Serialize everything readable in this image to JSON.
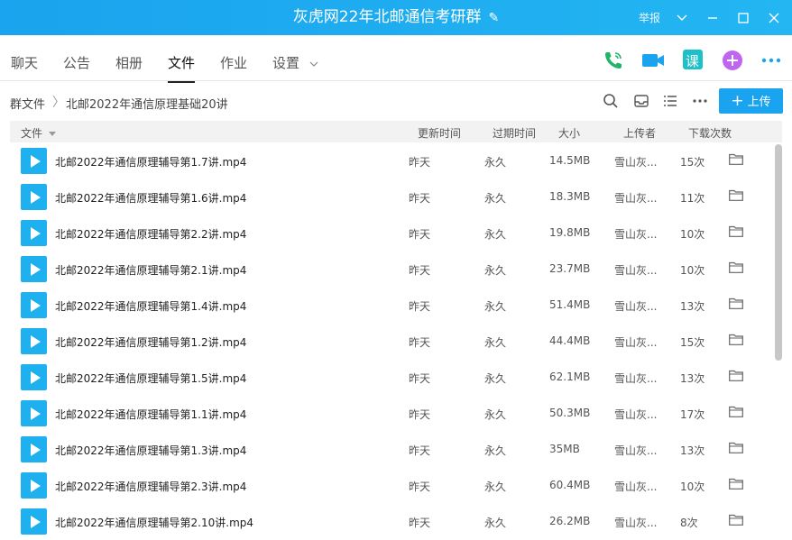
{
  "window": {
    "title": "灰虎网22年北邮通信考研群",
    "edit_icon": "pencil-icon",
    "report": "举报",
    "controls": [
      "chevron-down-icon",
      "minimize-icon",
      "maximize-icon",
      "close-icon"
    ]
  },
  "tabs": [
    {
      "label": "聊天"
    },
    {
      "label": "公告"
    },
    {
      "label": "相册"
    },
    {
      "label": "文件",
      "active": true
    },
    {
      "label": "作业"
    },
    {
      "label": "设置"
    }
  ],
  "tab_icons": [
    "phone-icon",
    "video-icon",
    "class-icon",
    "add-app-icon",
    "more-icon"
  ],
  "class_icon_text": "课",
  "path": {
    "root": "群文件",
    "current": "北邮2022年通信原理基础20讲"
  },
  "upload_label": "上传",
  "columns": {
    "file": "文件",
    "updated": "更新时间",
    "expires": "过期时间",
    "size": "大小",
    "uploader": "上传者",
    "downloads": "下载次数"
  },
  "files": [
    {
      "name": "北邮2022年通信原理辅导第1.7讲.mp4",
      "updated": "昨天",
      "expires": "永久",
      "size": "14.5MB",
      "uploader": "雪山灰...",
      "downloads": "15次"
    },
    {
      "name": "北邮2022年通信原理辅导第1.6讲.mp4",
      "updated": "昨天",
      "expires": "永久",
      "size": "18.3MB",
      "uploader": "雪山灰...",
      "downloads": "11次"
    },
    {
      "name": "北邮2022年通信原理辅导第2.2讲.mp4",
      "updated": "昨天",
      "expires": "永久",
      "size": "19.8MB",
      "uploader": "雪山灰...",
      "downloads": "10次"
    },
    {
      "name": "北邮2022年通信原理辅导第2.1讲.mp4",
      "updated": "昨天",
      "expires": "永久",
      "size": "23.7MB",
      "uploader": "雪山灰...",
      "downloads": "10次"
    },
    {
      "name": "北邮2022年通信原理辅导第1.4讲.mp4",
      "updated": "昨天",
      "expires": "永久",
      "size": "51.4MB",
      "uploader": "雪山灰...",
      "downloads": "13次"
    },
    {
      "name": "北邮2022年通信原理辅导第1.2讲.mp4",
      "updated": "昨天",
      "expires": "永久",
      "size": "44.4MB",
      "uploader": "雪山灰...",
      "downloads": "15次"
    },
    {
      "name": "北邮2022年通信原理辅导第1.5讲.mp4",
      "updated": "昨天",
      "expires": "永久",
      "size": "62.1MB",
      "uploader": "雪山灰...",
      "downloads": "13次"
    },
    {
      "name": "北邮2022年通信原理辅导第1.1讲.mp4",
      "updated": "昨天",
      "expires": "永久",
      "size": "50.3MB",
      "uploader": "雪山灰...",
      "downloads": "17次"
    },
    {
      "name": "北邮2022年通信原理辅导第1.3讲.mp4",
      "updated": "昨天",
      "expires": "永久",
      "size": "35MB",
      "uploader": "雪山灰...",
      "downloads": "13次"
    },
    {
      "name": "北邮2022年通信原理辅导第2.3讲.mp4",
      "updated": "昨天",
      "expires": "永久",
      "size": "60.4MB",
      "uploader": "雪山灰...",
      "downloads": "10次"
    },
    {
      "name": "北邮2022年通信原理辅导第2.10讲.mp4",
      "updated": "昨天",
      "expires": "永久",
      "size": "26.2MB",
      "uploader": "雪山灰...",
      "downloads": "8次"
    }
  ],
  "colors": {
    "accent": "#1aa3ee",
    "play": "#1fb0ef",
    "phone": "#22b46a",
    "video": "#1aa3ee",
    "class": "#1cc0c8",
    "add": "#c065f0"
  }
}
